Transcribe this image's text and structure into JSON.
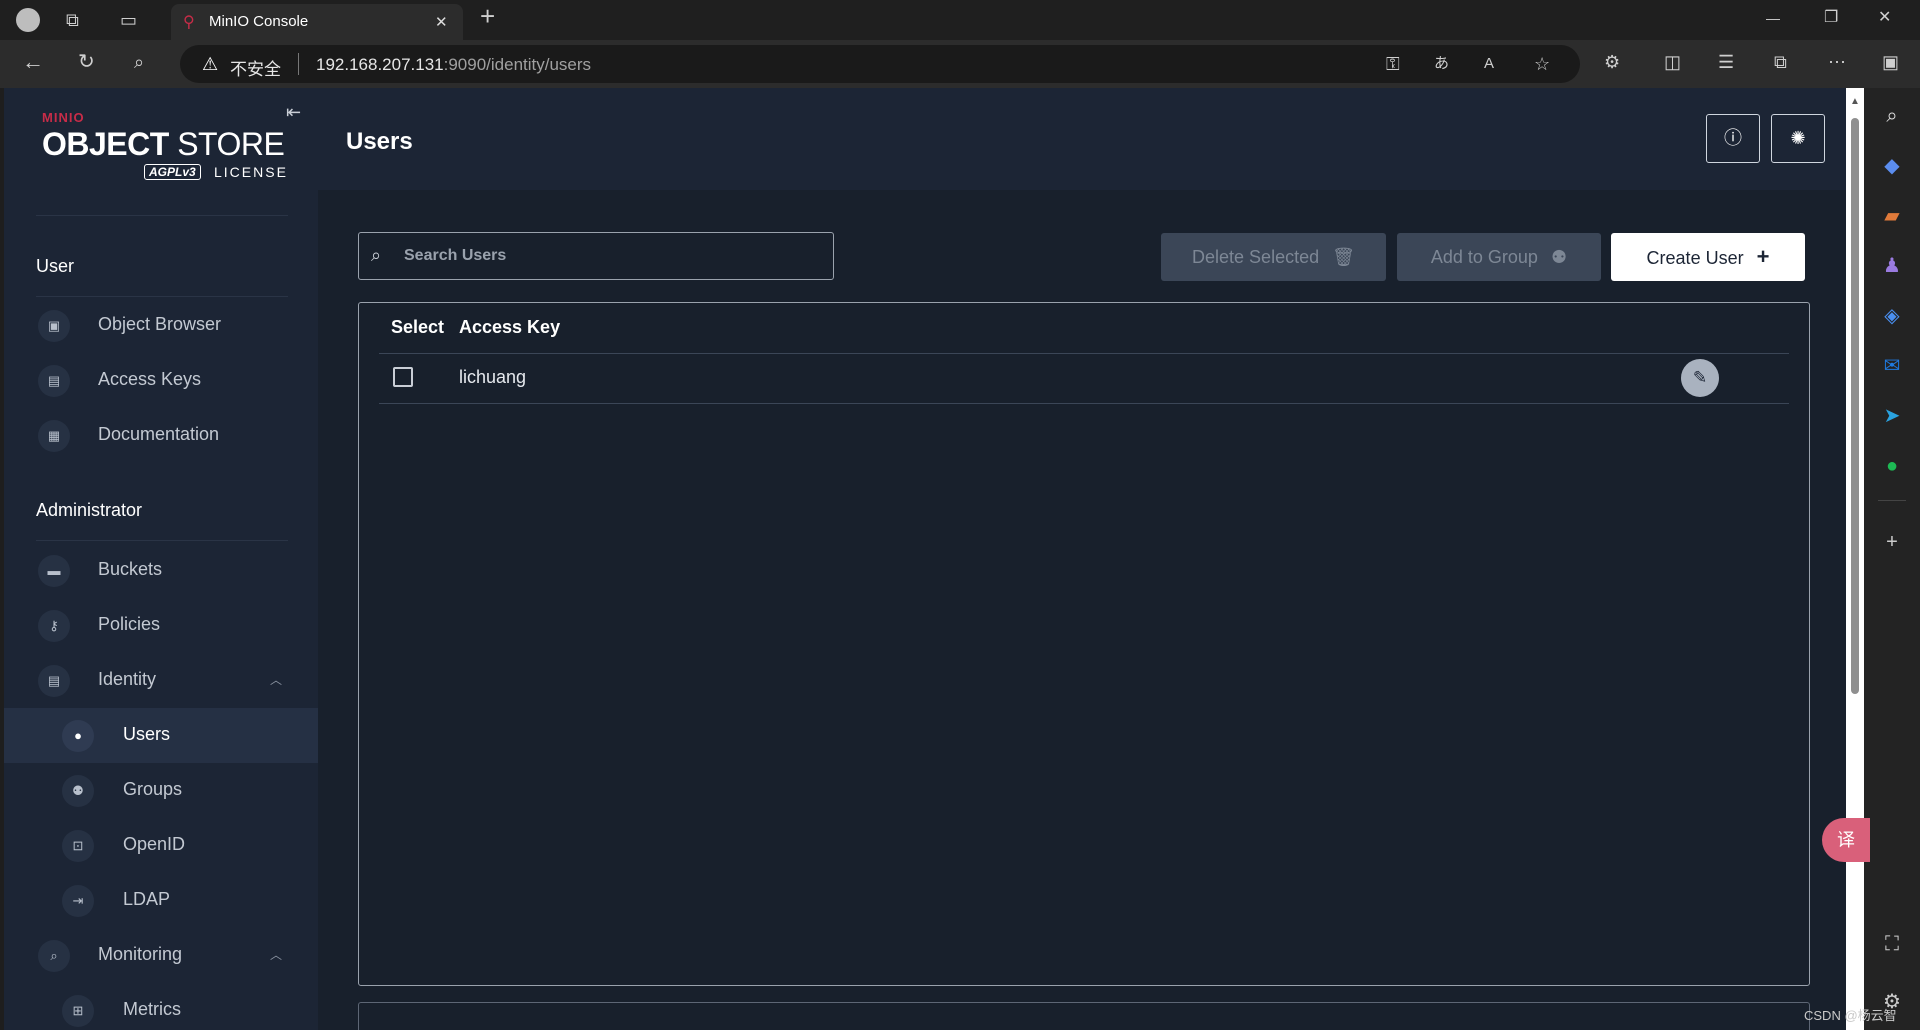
{
  "browser": {
    "tab_title": "MinIO Console",
    "tab_close": "✕",
    "new_tab": "+",
    "security_label": "不安全",
    "url_host": "192.168.207.131",
    "url_rest": ":9090/identity/users",
    "window_controls": {
      "minimize": "—",
      "restore": "❐",
      "close": "✕"
    }
  },
  "brand": {
    "top": "MINIO",
    "main_bold": "OBJECT",
    "main_light": " STORE",
    "agpl": "AGPLv3",
    "license": "LICENSE"
  },
  "sidebar": {
    "user_section": "User",
    "user_items": [
      {
        "label": "Object Browser",
        "icon": "object-browser-icon"
      },
      {
        "label": "Access Keys",
        "icon": "access-keys-icon"
      },
      {
        "label": "Documentation",
        "icon": "documentation-icon"
      }
    ],
    "admin_section": "Administrator",
    "admin_items": [
      {
        "label": "Buckets",
        "icon": "buckets-icon"
      },
      {
        "label": "Policies",
        "icon": "policies-icon"
      },
      {
        "label": "Identity",
        "icon": "identity-icon",
        "expanded": true
      },
      {
        "label": "Users",
        "icon": "user-icon",
        "active": true
      },
      {
        "label": "Groups",
        "icon": "groups-icon"
      },
      {
        "label": "OpenID",
        "icon": "openid-icon"
      },
      {
        "label": "LDAP",
        "icon": "ldap-icon"
      },
      {
        "label": "Monitoring",
        "icon": "monitoring-icon",
        "expanded": true
      },
      {
        "label": "Metrics",
        "icon": "metrics-icon"
      }
    ]
  },
  "header": {
    "title": "Users"
  },
  "toolbar": {
    "search_placeholder": "Search Users",
    "delete_selected": "Delete Selected",
    "add_to_group": "Add to Group",
    "create_user": "Create User"
  },
  "table": {
    "columns": [
      "Select",
      "Access Key"
    ],
    "rows": [
      {
        "access_key": "lichuang",
        "selected": false
      }
    ]
  },
  "footer": {
    "watermark": "CSDN @杨云智"
  },
  "colors": {
    "app_bg": "#18202c",
    "sidebar_bg": "#1c2535",
    "brand_red": "#c72c48",
    "primary_button": "#ffffff"
  }
}
